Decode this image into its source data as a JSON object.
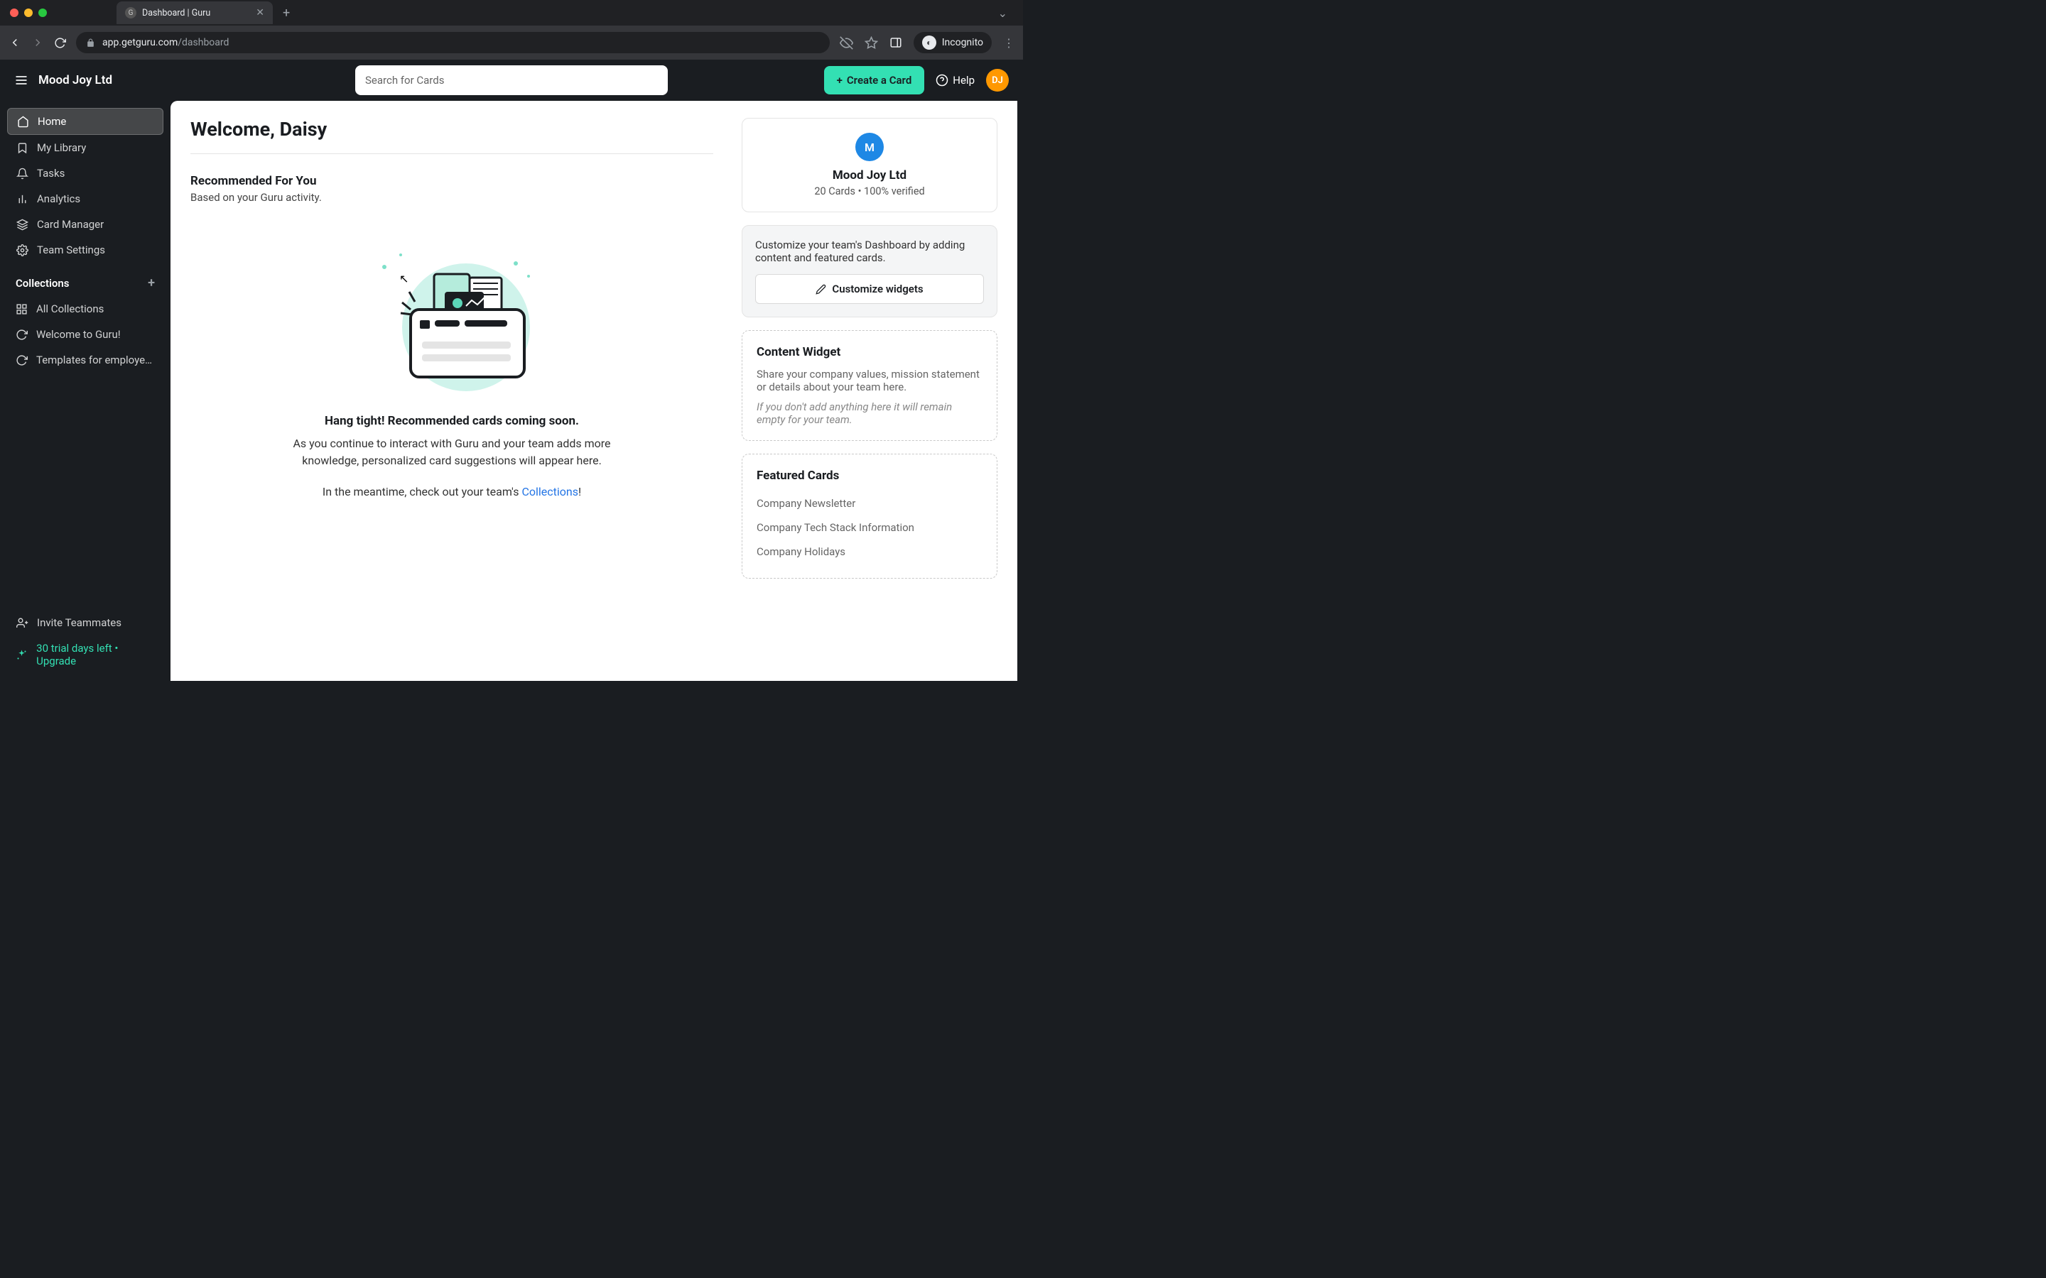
{
  "browser": {
    "tab_title": "Dashboard | Guru",
    "url_host": "app.getguru.com",
    "url_path": "/dashboard",
    "incognito_label": "Incognito"
  },
  "header": {
    "org_name": "Mood Joy Ltd",
    "search_placeholder": "Search for Cards",
    "create_label": "Create a Card",
    "help_label": "Help",
    "avatar_initials": "DJ"
  },
  "sidebar": {
    "nav": [
      {
        "label": "Home",
        "active": true
      },
      {
        "label": "My Library"
      },
      {
        "label": "Tasks"
      },
      {
        "label": "Analytics"
      },
      {
        "label": "Card Manager"
      },
      {
        "label": "Team Settings"
      }
    ],
    "collections_heading": "Collections",
    "collections": [
      {
        "label": "All Collections"
      },
      {
        "label": "Welcome to Guru!"
      },
      {
        "label": "Templates for employee ..."
      }
    ],
    "invite_label": "Invite Teammates",
    "trial_label": "30 trial days left • Upgrade"
  },
  "main": {
    "welcome": "Welcome, Daisy",
    "recommend_title": "Recommended For You",
    "recommend_sub": "Based on your Guru activity.",
    "empty_title": "Hang tight! Recommended cards coming soon.",
    "empty_body": "As you continue to interact with Guru and your team adds more knowledge, personalized card suggestions will appear here.",
    "meantime_prefix": "In the meantime, check out your team's ",
    "meantime_link": "Collections",
    "meantime_suffix": "!"
  },
  "right": {
    "org_initial": "M",
    "org_name": "Mood Joy Ltd",
    "org_stats": "20 Cards • 100% verified",
    "customize_text": "Customize your team's Dashboard by adding content and featured cards.",
    "customize_btn": "Customize widgets",
    "content_widget_title": "Content Widget",
    "content_widget_text": "Share your company values, mission statement or details about your team here.",
    "content_widget_hint": "If you don't add anything here it will remain empty for your team.",
    "featured_title": "Featured Cards",
    "featured": [
      "Company Newsletter",
      "Company Tech Stack Information",
      "Company Holidays"
    ]
  }
}
